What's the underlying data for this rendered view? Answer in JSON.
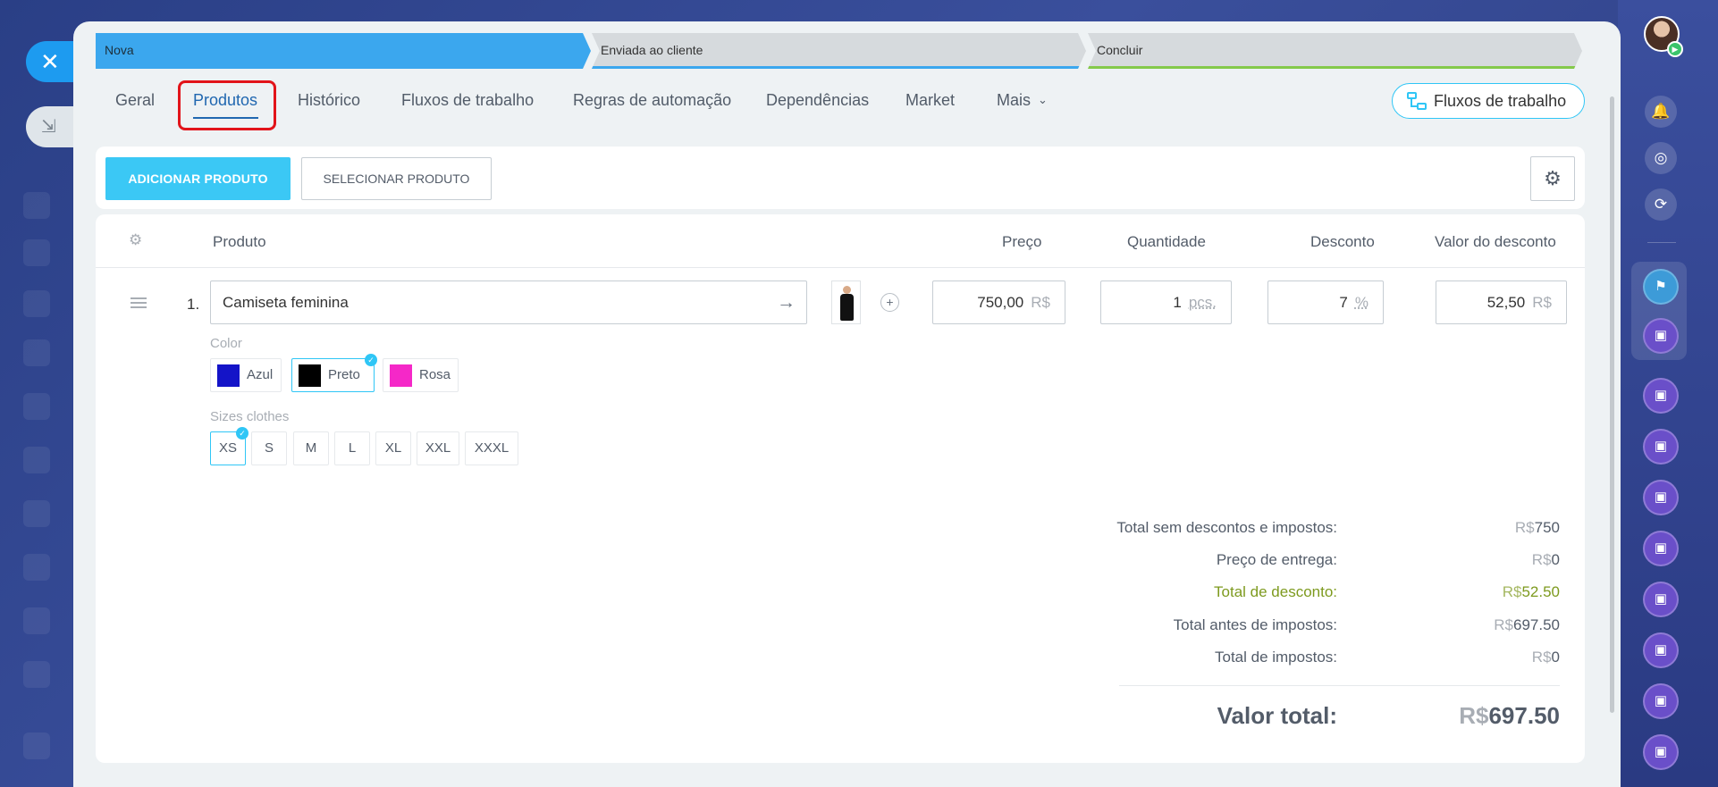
{
  "stages": [
    "Nova",
    "Enviada ao cliente",
    "Concluir"
  ],
  "tabs": {
    "geral": "Geral",
    "produtos": "Produtos",
    "historico": "Histórico",
    "fluxos": "Fluxos de trabalho",
    "regras": "Regras de automação",
    "dependencias": "Dependências",
    "market": "Market",
    "mais": "Mais"
  },
  "workflows_button": "Fluxos de trabalho",
  "toolbar": {
    "add_label": "ADICIONAR PRODUTO",
    "select_label": "SELECIONAR PRODUTO"
  },
  "table": {
    "headers": {
      "product": "Produto",
      "price": "Preço",
      "quantity": "Quantidade",
      "discount": "Desconto",
      "discount_value": "Valor do desconto"
    },
    "row": {
      "number": "1.",
      "name": "Camiseta feminina",
      "price": "750,00",
      "price_unit": "R$",
      "quantity": "1",
      "quantity_unit": "pcs.",
      "discount": "7",
      "discount_unit": "%",
      "discount_value": "52,50",
      "discount_value_unit": "R$"
    },
    "color_label": "Color",
    "colors": [
      {
        "name": "Azul",
        "hex": "#1414c8"
      },
      {
        "name": "Preto",
        "hex": "#000000",
        "selected": true
      },
      {
        "name": "Rosa",
        "hex": "#f528c8"
      }
    ],
    "sizes_label": "Sizes clothes",
    "sizes": [
      "XS",
      "S",
      "M",
      "L",
      "XL",
      "XXL",
      "XXXL"
    ],
    "selected_size": "XS"
  },
  "summary": {
    "currency": "R$",
    "rows": [
      {
        "label": "Total sem descontos e impostos:",
        "value": "750"
      },
      {
        "label": "Preço de entrega:",
        "value": "0"
      },
      {
        "label": "Total de desconto:",
        "value": "52.50"
      },
      {
        "label": "Total antes de impostos:",
        "value": "697.50"
      },
      {
        "label": "Total de impostos:",
        "value": "0"
      }
    ],
    "total_label": "Valor total:",
    "total_value": "697.50"
  },
  "colors": {
    "accent": "#3bc8f5",
    "active_tab": "#2067b0",
    "highlight": "#e2141a",
    "stage_active": "#3ba7ee",
    "discount_total": "#7d9a1e"
  }
}
